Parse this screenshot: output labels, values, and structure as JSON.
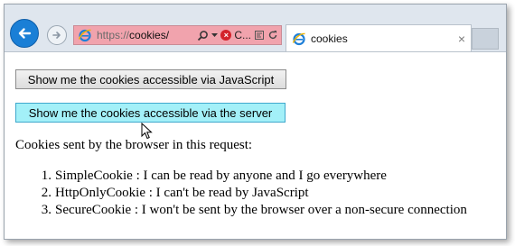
{
  "browser": {
    "address": {
      "protocol": "https://",
      "host": "cookies/",
      "tab_title_fragment": "C..."
    },
    "tab": {
      "title": "cookies",
      "close": "×"
    },
    "icons": {
      "back": "back-arrow-icon",
      "forward": "forward-arrow-icon",
      "page": "internet-explorer-icon",
      "search": "search-icon",
      "certificate_error": "certificate-error-icon",
      "compatibility": "compatibility-view-icon",
      "refresh": "refresh-icon"
    },
    "colors": {
      "address_bar_error": "#f1a3ad",
      "back_button": "#1a7fd6"
    }
  },
  "page": {
    "buttons": {
      "js": "Show me the cookies accessible via JavaScript",
      "server": "Show me the cookies accessible via the server"
    },
    "intro": "Cookies sent by the browser in this request:",
    "cookies": [
      {
        "num": "1.",
        "text": "SimpleCookie : I can be read by anyone and I go everywhere"
      },
      {
        "num": "2.",
        "text": "HttpOnlyCookie : I can't be read by JavaScript"
      },
      {
        "num": "3.",
        "text": "SecureCookie : I won't be sent by the browser over a non-secure connection"
      }
    ],
    "colors": {
      "hovered_button": "#a3f0f8"
    }
  }
}
